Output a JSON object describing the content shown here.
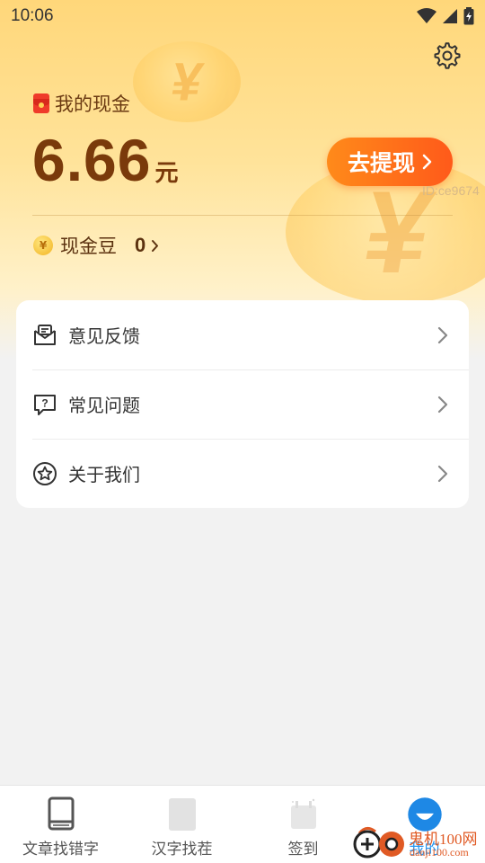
{
  "status": {
    "time": "10:06"
  },
  "cash": {
    "title": "我的现金",
    "amount": "6.66",
    "unit": "元",
    "withdraw_label": "去提现",
    "user_id": "ID:ce9674",
    "beans_label": "现金豆",
    "beans_value": "0"
  },
  "menu": {
    "items": [
      {
        "label": "意见反馈",
        "icon": "feedback-mail-icon"
      },
      {
        "label": "常见问题",
        "icon": "question-bubble-icon"
      },
      {
        "label": "关于我们",
        "icon": "star-circle-icon"
      }
    ]
  },
  "tabs": [
    {
      "label": "文章找错字",
      "icon": "book-icon",
      "active": false
    },
    {
      "label": "汉字找茬",
      "icon": "card-icon",
      "active": false
    },
    {
      "label": "签到",
      "icon": "calendar-icon",
      "active": false
    },
    {
      "label": "我的",
      "icon": "profile-icon",
      "active": true
    }
  ],
  "watermark": {
    "text": "鬼机100网",
    "url": "danji100.com"
  },
  "colors": {
    "accent_orange": "#ff6a1a",
    "amount_brown": "#7a3a0b",
    "active_tab_blue": "#2196f3"
  }
}
